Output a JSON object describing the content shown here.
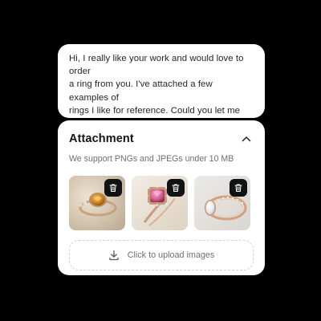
{
  "message": {
    "text": "Hi, I really like your work and would love to order\na ring from you. I've attached a few examples of\nrings I like for reference. Could you let me know\nhow much something similar would cost and how\nlong it would take to make?"
  },
  "attachment": {
    "title": "Attachment",
    "subtitle": "We support PNGs and JPEGs under 10 MB",
    "collapse_icon": "chevron-up-icon",
    "images": [
      {
        "name": "ring-orange-gem",
        "delete_icon": "trash-icon"
      },
      {
        "name": "ring-pink-gem",
        "delete_icon": "trash-icon"
      },
      {
        "name": "ring-white-gem",
        "delete_icon": "trash-icon"
      }
    ],
    "upload": {
      "label": "Click to upload images",
      "icon": "download-icon"
    }
  },
  "colors": {
    "background": "#000000",
    "card": "#ffffff",
    "text": "#1f2328",
    "muted": "#6b6f76",
    "trash_button": "#111214",
    "dashed_border": "#cfd2d6"
  }
}
